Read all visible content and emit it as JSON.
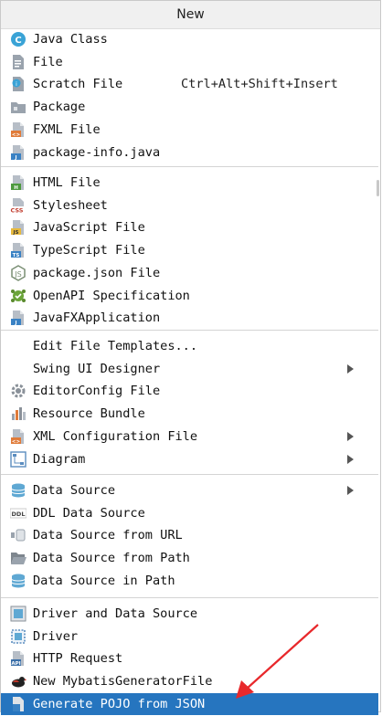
{
  "menu": {
    "title": "New",
    "groups": [
      [
        {
          "label": "Java Class",
          "icon": "java-class-icon"
        },
        {
          "label": "File",
          "icon": "file-icon"
        },
        {
          "label": "Scratch File",
          "icon": "scratch-file-icon",
          "shortcut": "Ctrl+Alt+Shift+Insert"
        },
        {
          "label": "Package",
          "icon": "package-folder-icon"
        },
        {
          "label": "FXML File",
          "icon": "fxml-file-icon"
        },
        {
          "label": "package-info.java",
          "icon": "java-file-icon"
        }
      ],
      [
        {
          "label": "HTML File",
          "icon": "html-file-icon"
        },
        {
          "label": "Stylesheet",
          "icon": "css-file-icon"
        },
        {
          "label": "JavaScript File",
          "icon": "javascript-file-icon"
        },
        {
          "label": "TypeScript File",
          "icon": "typescript-file-icon"
        },
        {
          "label": "package.json File",
          "icon": "nodejs-icon"
        },
        {
          "label": "OpenAPI Specification",
          "icon": "openapi-icon"
        },
        {
          "label": "JavaFXApplication",
          "icon": "java-file-icon"
        }
      ],
      [
        {
          "label": "Edit File Templates...",
          "icon": ""
        },
        {
          "label": "Swing UI Designer",
          "icon": "",
          "submenu": true
        },
        {
          "label": "EditorConfig File",
          "icon": "gear-icon"
        },
        {
          "label": "Resource Bundle",
          "icon": "resource-bundle-icon"
        },
        {
          "label": "XML Configuration File",
          "icon": "xml-file-icon",
          "submenu": true
        },
        {
          "label": "Diagram",
          "icon": "diagram-icon",
          "submenu": true
        }
      ],
      [
        {
          "label": "Data Source",
          "icon": "database-icon",
          "submenu": true
        },
        {
          "label": "DDL Data Source",
          "icon": "ddl-icon"
        },
        {
          "label": "Data Source from URL",
          "icon": "url-datasource-icon"
        },
        {
          "label": "Data Source from Path",
          "icon": "folder-open-icon"
        },
        {
          "label": "Data Source in Path",
          "icon": "database-icon"
        }
      ],
      [
        {
          "label": "Driver and Data Source",
          "icon": "driver-datasource-icon"
        },
        {
          "label": "Driver",
          "icon": "driver-icon"
        },
        {
          "label": "HTTP Request",
          "icon": "api-icon"
        },
        {
          "label": "New MybatisGeneratorFile",
          "icon": "mybatis-bird-icon"
        },
        {
          "label": "Generate POJO from JSON",
          "icon": "pojo-file-icon",
          "selected": true
        }
      ]
    ]
  },
  "colors": {
    "selection": "#2675bf",
    "annotation_arrow": "#e8282b"
  }
}
